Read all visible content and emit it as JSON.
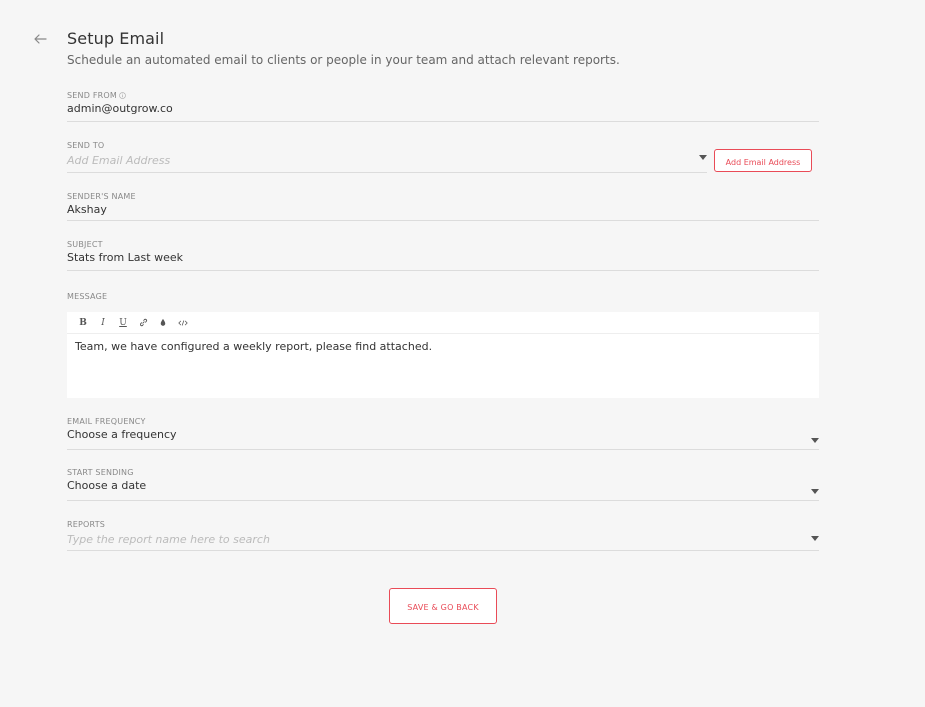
{
  "header": {
    "title": "Setup Email",
    "subtitle": "Schedule an automated email to clients or people in your team and attach relevant reports."
  },
  "form": {
    "send_from": {
      "label": "SEND FROM",
      "value": "admin@outgrow.co"
    },
    "send_to": {
      "label": "SEND TO",
      "placeholder": "Add Email Address",
      "add_button": "Add Email Address"
    },
    "sender_name": {
      "label": "SENDER'S NAME",
      "value": "Akshay"
    },
    "subject": {
      "label": "SUBJECT",
      "value": "Stats from Last week"
    },
    "message": {
      "label": "MESSAGE",
      "toolbar": [
        "B",
        "I",
        "U",
        "link",
        "color",
        "code"
      ],
      "body": "Team, we have configured a weekly report, please find attached."
    },
    "email_frequency": {
      "label": "EMAIL FREQUENCY",
      "value": "Choose a frequency"
    },
    "start_sending": {
      "label": "START SENDING",
      "value": "Choose a date"
    },
    "reports": {
      "label": "REPORTS",
      "placeholder": "Type the report name here to search"
    }
  },
  "actions": {
    "save_label": "SAVE & GO BACK"
  },
  "colors": {
    "accent": "#e94b57",
    "background": "#f6f6f6",
    "divider": "#dcdcdc"
  },
  "icons": [
    "back-arrow-icon",
    "info-icon",
    "chevron-down-icon",
    "link-icon",
    "color-drop-icon",
    "code-icon"
  ]
}
